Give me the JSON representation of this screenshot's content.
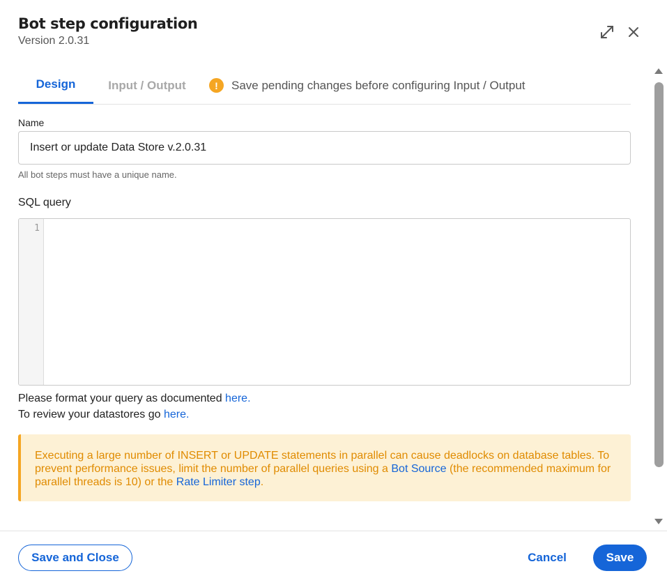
{
  "header": {
    "title": "Bot step configuration",
    "version": "Version 2.0.31",
    "expand_icon": "expand-icon",
    "close_icon": "close-icon"
  },
  "tabs": [
    {
      "label": "Design",
      "active": true
    },
    {
      "label": "Input / Output",
      "active": false
    }
  ],
  "tab_warning": {
    "icon": "!",
    "text": "Save pending changes before configuring Input / Output"
  },
  "name_field": {
    "label": "Name",
    "value": "Insert or update Data Store v.2.0.31",
    "helper": "All bot steps must have a unique name."
  },
  "sql": {
    "label": "SQL query",
    "line_number": "1",
    "query": ""
  },
  "info": {
    "line1_prefix": "Please format your query as documented ",
    "line1_link": "here.",
    "line2_prefix": "To review your datastores go ",
    "line2_link": "here."
  },
  "alert": {
    "part1": "Executing a large number of INSERT or UPDATE statements in parallel can cause deadlocks on database tables. To prevent performance issues, limit the number of parallel queries using a ",
    "link1": "Bot Source",
    "part2": " (the recommended maximum for parallel threads is 10) or the ",
    "link2": "Rate Limiter step",
    "part3": ".",
    "accent_color": "#f5a623",
    "background_color": "#fdf1d5"
  },
  "footer": {
    "save_close_label": "Save and Close",
    "cancel_label": "Cancel",
    "save_label": "Save"
  },
  "colors": {
    "primary": "#1565d8"
  }
}
